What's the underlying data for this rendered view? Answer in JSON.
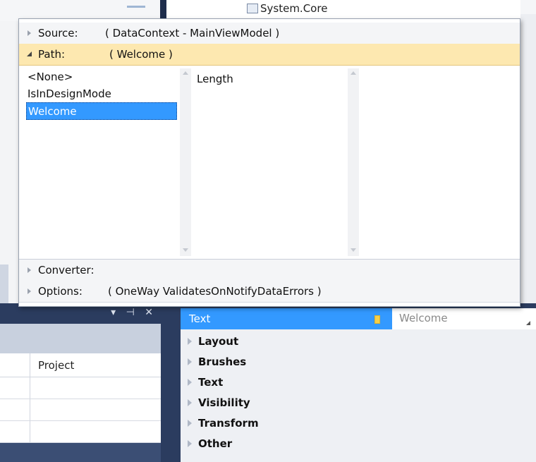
{
  "background": {
    "solution_tree_item": "System.Core",
    "solution_panel_controls": "▾ ⊣ ✕",
    "solution_column_header": "Project"
  },
  "binding_popup": {
    "source": {
      "label": "Source:",
      "value": "( DataContext - MainViewModel )"
    },
    "path": {
      "label": "Path:",
      "value": "( Welcome )"
    },
    "path_list": [
      "<None>",
      "IsInDesignMode",
      "Welcome"
    ],
    "selected_path_item": "Welcome",
    "sub_path_list": [
      "Length"
    ],
    "converter": {
      "label": "Converter:"
    },
    "options": {
      "label": "Options:",
      "value": "( OneWay ValidatesOnNotifyDataErrors )"
    }
  },
  "properties": {
    "selected_property": {
      "name": "Text",
      "value": "Welcome"
    },
    "categories": [
      "Layout",
      "Brushes",
      "Text",
      "Visibility",
      "Transform",
      "Other"
    ]
  },
  "colors": {
    "selection": "#3399ff",
    "path_row": "#fde8b0",
    "panel_navy": "#2b3c5f"
  }
}
